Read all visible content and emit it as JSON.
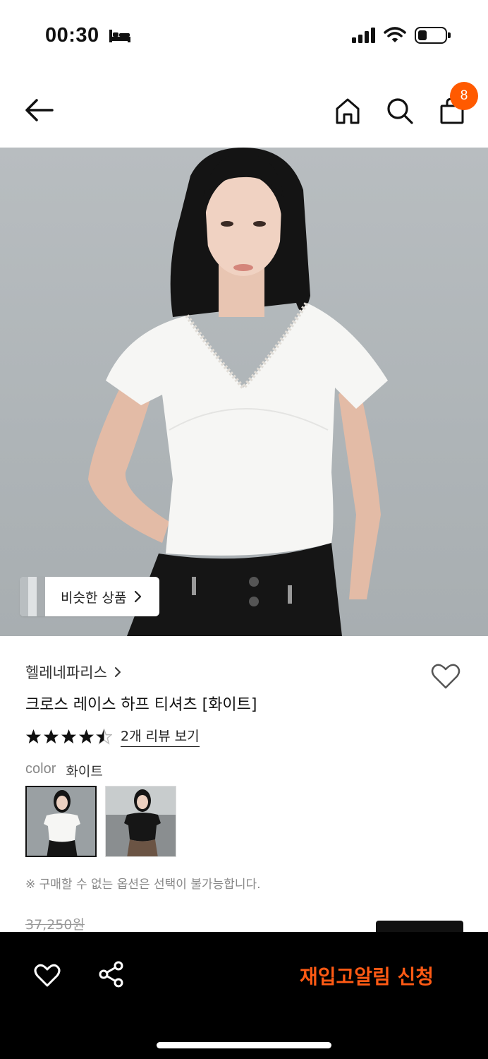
{
  "status_bar": {
    "time": "00:30",
    "icons": [
      "bed-icon",
      "signal-icon",
      "wifi-icon",
      "battery-icon"
    ]
  },
  "nav": {
    "icons": [
      "back-arrow-icon",
      "home-icon",
      "search-icon",
      "shopping-bag-icon"
    ],
    "cart_count": "8"
  },
  "hero": {
    "similar_products_label": "비슷한 상품"
  },
  "product": {
    "brand": "헬레네파리스",
    "title": "크로스 레이스 하프 티셔츠 [화이트]",
    "rating": 4.5,
    "review_link": "2개 리뷰 보기",
    "color_label": "color",
    "color_value": "화이트",
    "swatches": [
      "white",
      "black"
    ],
    "notice": "※ 구매할 수 없는 옵션은 선택이 불가능합니다.",
    "original_price": "37,250원"
  },
  "bottom_bar": {
    "restock_button": "재입고알림 신청"
  },
  "colors": {
    "accent": "#ff5a00",
    "restock_text": "#ff5a14",
    "bottom_bar": "#000000"
  }
}
